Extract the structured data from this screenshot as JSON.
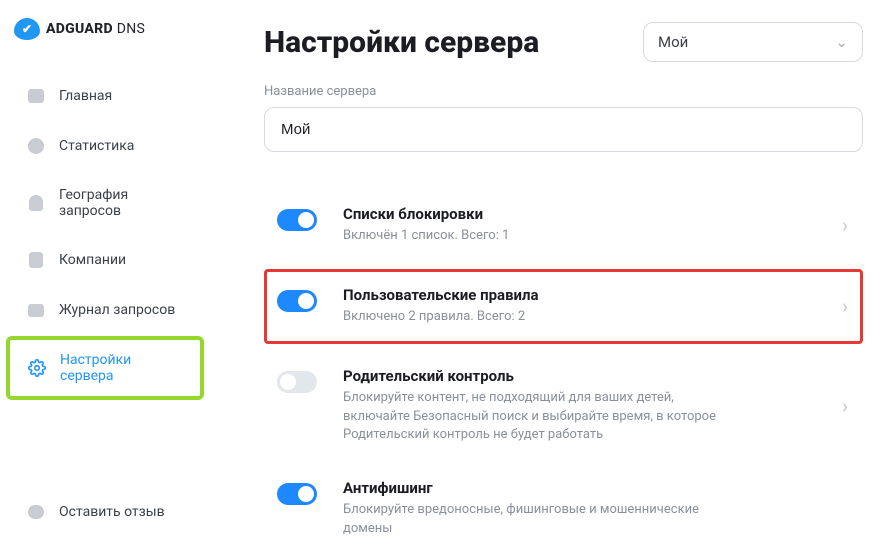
{
  "brand": {
    "name": "ADGUARD",
    "suffix": "DNS"
  },
  "sidebar": {
    "items": [
      {
        "label": "Главная"
      },
      {
        "label": "Статистика"
      },
      {
        "label": "География запросов"
      },
      {
        "label": "Компании"
      },
      {
        "label": "Журнал запросов"
      },
      {
        "label": "Настройки сервера"
      }
    ],
    "footer": {
      "label": "Оставить отзыв"
    }
  },
  "header": {
    "title": "Настройки сервера",
    "server_selected": "Мой"
  },
  "server_name": {
    "label": "Название сервера",
    "value": "Мой"
  },
  "settings": [
    {
      "title": "Списки блокировки",
      "sub": "Включён 1 список. Всего: 1",
      "on": true,
      "disabled": false
    },
    {
      "title": "Пользовательские правила",
      "sub": "Включено 2 правила. Всего: 2",
      "on": true,
      "disabled": false
    },
    {
      "title": "Родительский контроль",
      "sub": "Блокируйте контент, не подходящий для ваших детей, включайте Безопасный поиск и выбирайте время, в которое Родительский контроль не будет работать",
      "on": false,
      "disabled": true
    },
    {
      "title": "Антифишинг",
      "sub": "Блокируйте вредоносные, фишинговые и мошеннические домены",
      "on": true,
      "disabled": false
    }
  ]
}
